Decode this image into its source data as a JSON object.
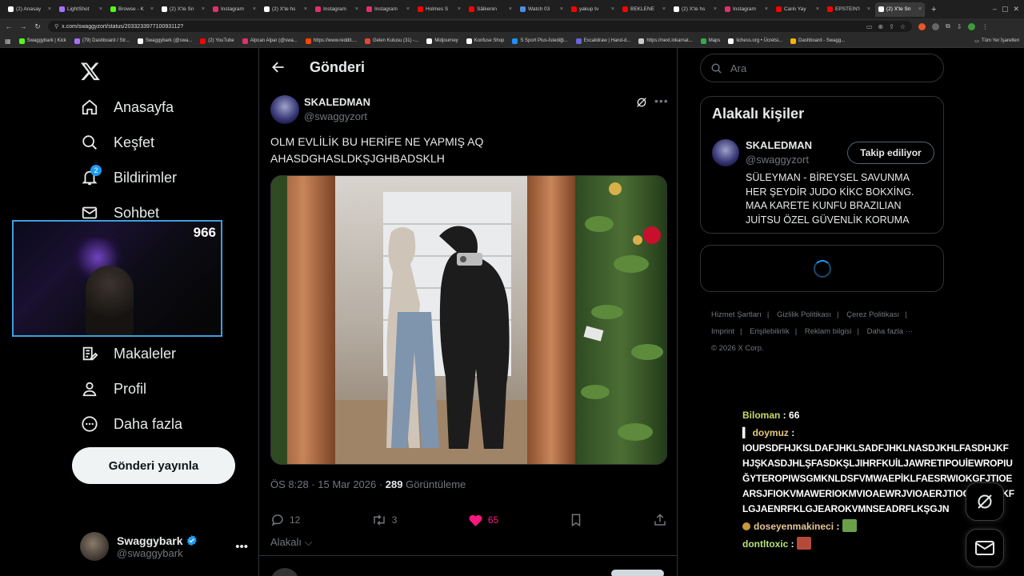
{
  "browser": {
    "tabs": [
      {
        "label": "(2) Anasay",
        "color": "#ffffff"
      },
      {
        "label": "LightShot",
        "color": "#a472ff"
      },
      {
        "label": "Browse - K",
        "color": "#53fc18"
      },
      {
        "label": "(2) X'te Sn",
        "color": "#ffffff"
      },
      {
        "label": "Instagram",
        "color": "#e1306c"
      },
      {
        "label": "(2) X'te hs",
        "color": "#ffffff"
      },
      {
        "label": "Instagram",
        "color": "#e1306c"
      },
      {
        "label": "Instagram",
        "color": "#e1306c"
      },
      {
        "label": "Holmes S",
        "color": "#ff0000"
      },
      {
        "label": "Sâlkenin",
        "color": "#ff0000"
      },
      {
        "label": "Watch 03",
        "color": "#4a90e2"
      },
      {
        "label": "yakup tv",
        "color": "#ff0000"
      },
      {
        "label": "BEKLENE",
        "color": "#ff0000"
      },
      {
        "label": "(2) X'te hs",
        "color": "#ffffff"
      },
      {
        "label": "Instagram",
        "color": "#e1306c"
      },
      {
        "label": "Canlı Yay",
        "color": "#ff0000"
      },
      {
        "label": "EPSTEIN'I",
        "color": "#ff0000"
      },
      {
        "label": "(2) X'te Sn",
        "color": "#ffffff"
      }
    ],
    "url": "x.com/swaggyzort/status/203323397710093112?",
    "bookmarks": [
      {
        "label": "Swaggybark | Kick",
        "color": "#53fc18"
      },
      {
        "label": "(79) Dashboard / Str...",
        "color": "#a472ff"
      },
      {
        "label": "Swaggybark (@swa...",
        "color": "#ffffff"
      },
      {
        "label": "(2) YouTube",
        "color": "#ff0000"
      },
      {
        "label": "Alpcan Alpar (@swa...",
        "color": "#e1306c"
      },
      {
        "label": "https://www.reddit....",
        "color": "#ff4500"
      },
      {
        "label": "Gelen Kutusu (31) -...",
        "color": "#ea4335"
      },
      {
        "label": "Midjourney",
        "color": "#ffffff"
      },
      {
        "label": "Konfuse Shop",
        "color": "#ffffff"
      },
      {
        "label": "S Sport Plus-İstediği...",
        "color": "#1e90ff"
      },
      {
        "label": "Excalidraw | Hand-d...",
        "color": "#6965db"
      },
      {
        "label": "https://next.inkarnat...",
        "color": "#cccccc"
      },
      {
        "label": "Maps",
        "color": "#34a853"
      },
      {
        "label": "lichess.org • Ücretsi...",
        "color": "#ffffff"
      },
      {
        "label": "Dashboard - Swagg...",
        "color": "#f4b400"
      }
    ],
    "bookmarks_all": "Tüm Yer İşaretleri"
  },
  "nav": {
    "items": [
      {
        "label": "Anasayfa",
        "icon": "home-icon"
      },
      {
        "label": "Keşfet",
        "icon": "search-icon"
      },
      {
        "label": "Bildirimler",
        "icon": "bell-icon",
        "badge": "2"
      },
      {
        "label": "Sohbet",
        "icon": "envelope-icon"
      },
      {
        "label": "Makaleler",
        "icon": "article-icon"
      },
      {
        "label": "Profil",
        "icon": "person-icon"
      },
      {
        "label": "Daha fazla",
        "icon": "more-circle-icon"
      }
    ],
    "post_button": "Gönderi yayınla",
    "account": {
      "name": "Swaggybark",
      "handle": "@swaggybark",
      "verified_color": "#1d9bf0"
    }
  },
  "webcam": {
    "viewer_count": "966"
  },
  "main": {
    "title": "Gönderi",
    "tweet": {
      "author_name": "SKALEDMAN",
      "author_handle": "@swaggyzort",
      "text_line1": "OLM EVLİLİK BU HERİFE NE YAPMIŞ AQ",
      "text_line2": "AHASDGHASLDKŞJGHBADSKLH",
      "time": "ÖS 8:28 · 15 Mar 2026 · ",
      "views": "289",
      "views_label": " Görüntüleme",
      "replies": "12",
      "retweets": "3",
      "likes": "65",
      "related_toggle": "Alakalı"
    }
  },
  "right": {
    "search_placeholder": "Ara",
    "related_title": "Alakalı kişiler",
    "related_person": {
      "name": "SKALEDMAN",
      "handle": "@swaggyzort",
      "follow_label": "Takip ediliyor",
      "bio": "SÜLEYMAN - BİREYSEL SAVUNMA HER ŞEYDİR JUDO KİKC BOKXİNG. MAA KARETE KUNFU BRAZILIAN JUİTSU ÖZEL GÜVENLİK KORUMA"
    },
    "footer": [
      "Hizmet Şartları",
      "Gizlilik Politikası",
      "Çerez Politikası",
      "Imprint",
      "Erişilebilirlik",
      "Reklam bilgisi",
      "Daha fazla ···"
    ],
    "copyright": "© 2026 X Corp."
  },
  "chat": {
    "messages": [
      {
        "user": "Biloman",
        "text": "66"
      },
      {
        "user": "doymuz",
        "text": "IOUPSDFHJKSLDAFJHKLSADFJHKLNASDJKHLFASDHJKFHJŞKASDJHLŞFASDKŞLJIHRFKUİLJAWRETIPOUİEWROPIUĞYTEROPIWSGMKNLDSFVMWAEPİKLFAESRWIOKGFJTIOEARSJFIOKVMAWERIOKMVIOAEWRJVIOAERJTIOGJASDRKFLGJAENRFKLGJEAROKVMNSEADRFLKŞGJN"
      },
      {
        "user": "doseyenmakineci",
        "text": ""
      },
      {
        "user": "dontltoxic",
        "text": ""
      }
    ]
  }
}
